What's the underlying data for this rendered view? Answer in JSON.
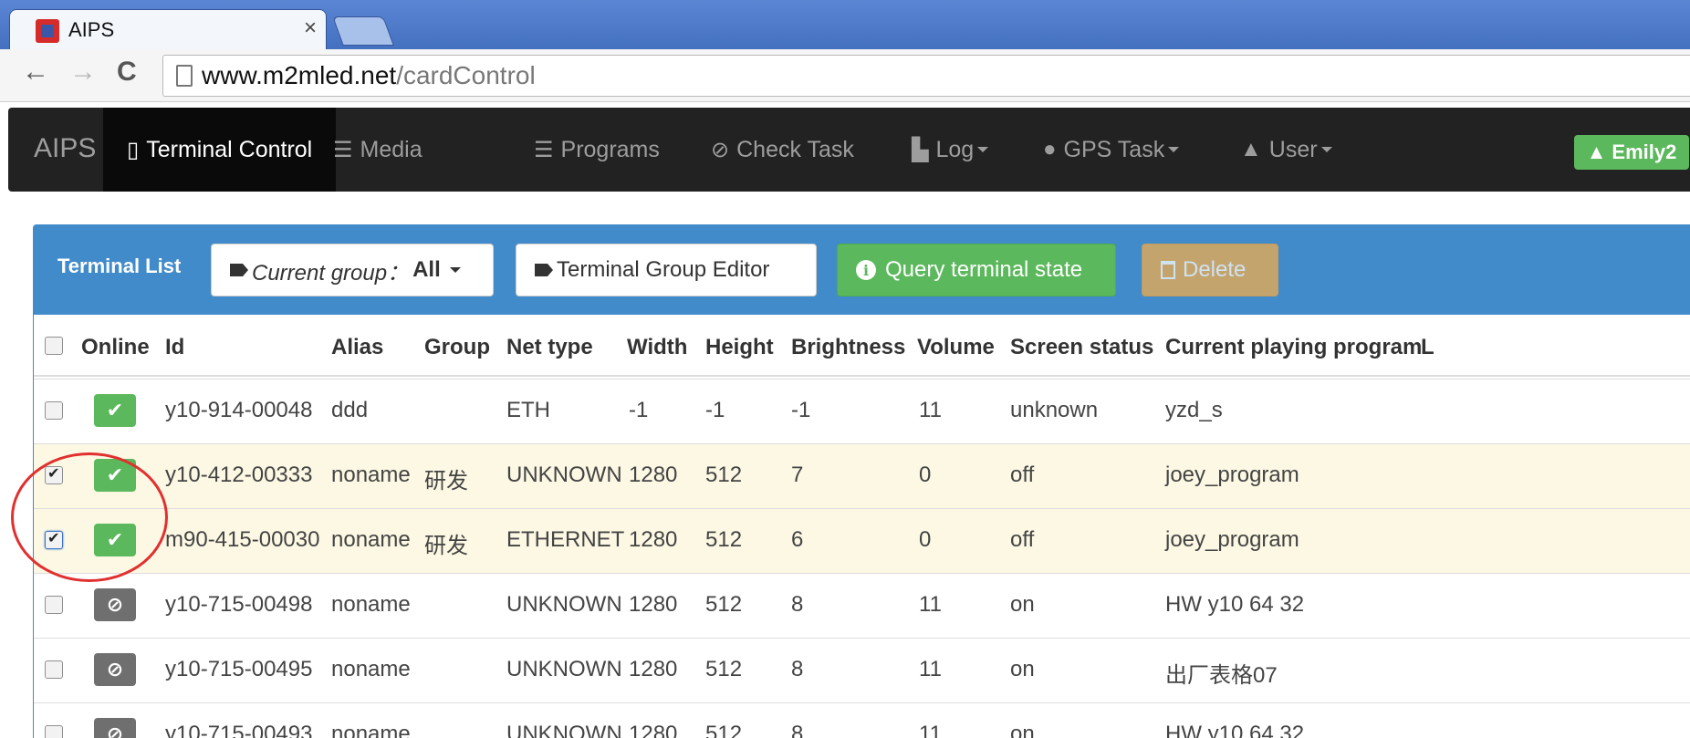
{
  "browser": {
    "tab_title": "AIPS",
    "url_domain": "www.m2mled.net",
    "url_path": "/cardControl"
  },
  "navbar": {
    "brand": "AIPS",
    "items": [
      {
        "label": "Terminal Control",
        "icon": "mobile-icon",
        "active": true
      },
      {
        "label": "Media",
        "icon": "hdd-icon"
      },
      {
        "label": "Programs",
        "icon": "list-icon"
      },
      {
        "label": "Check Task",
        "icon": "check-circle-icon"
      },
      {
        "label": "Log",
        "icon": "file-icon",
        "dropdown": true
      },
      {
        "label": "GPS Task",
        "icon": "globe-icon",
        "dropdown": true
      },
      {
        "label": "User",
        "icon": "user-icon",
        "dropdown": true
      }
    ],
    "current_user": "Emily2"
  },
  "panel": {
    "title": "Terminal List",
    "group_label": "Current group：",
    "group_value": "All",
    "editor_button": "Terminal Group Editor",
    "query_button": "Query terminal state",
    "delete_button": "Delete"
  },
  "table": {
    "headers": [
      "Online",
      "Id",
      "Alias",
      "Group",
      "Net type",
      "Width",
      "Height",
      "Brightness",
      "Volume",
      "Screen status",
      "Current playing program",
      "L"
    ],
    "rows": [
      {
        "checked": false,
        "online": true,
        "id": "y10-914-00048",
        "alias": "ddd",
        "group": "",
        "net": "ETH",
        "width": "-1",
        "height": "-1",
        "brightness": "-1",
        "volume": "11",
        "screen": "unknown",
        "program": "yzd_s"
      },
      {
        "checked": true,
        "online": true,
        "id": "y10-412-00333",
        "alias": "noname",
        "group": "研发",
        "net": "UNKNOWN",
        "width": "1280",
        "height": "512",
        "brightness": "7",
        "volume": "0",
        "screen": "off",
        "program": "joey_program"
      },
      {
        "checked": true,
        "online": true,
        "id": "m90-415-00030",
        "alias": "noname",
        "group": "研发",
        "net": "ETHERNET",
        "width": "1280",
        "height": "512",
        "brightness": "6",
        "volume": "0",
        "screen": "off",
        "program": "joey_program"
      },
      {
        "checked": false,
        "online": false,
        "id": "y10-715-00498",
        "alias": "noname",
        "group": "",
        "net": "UNKNOWN",
        "width": "1280",
        "height": "512",
        "brightness": "8",
        "volume": "11",
        "screen": "on",
        "program": "HW y10 64 32"
      },
      {
        "checked": false,
        "online": false,
        "id": "y10-715-00495",
        "alias": "noname",
        "group": "",
        "net": "UNKNOWN",
        "width": "1280",
        "height": "512",
        "brightness": "8",
        "volume": "11",
        "screen": "on",
        "program": "出厂表格07"
      },
      {
        "checked": false,
        "online": false,
        "id": "y10-715-00493",
        "alias": "noname",
        "group": "",
        "net": "UNKNOWN",
        "width": "1280",
        "height": "512",
        "brightness": "8",
        "volume": "11",
        "screen": "on",
        "program": "HW y10 64 32"
      }
    ]
  },
  "colors": {
    "navbar": "#222222",
    "panel_primary": "#428bca",
    "success": "#5cb85c",
    "warning": "#f0ad4e",
    "selected_row": "#fcf8e3",
    "annotation": "#e03030"
  }
}
